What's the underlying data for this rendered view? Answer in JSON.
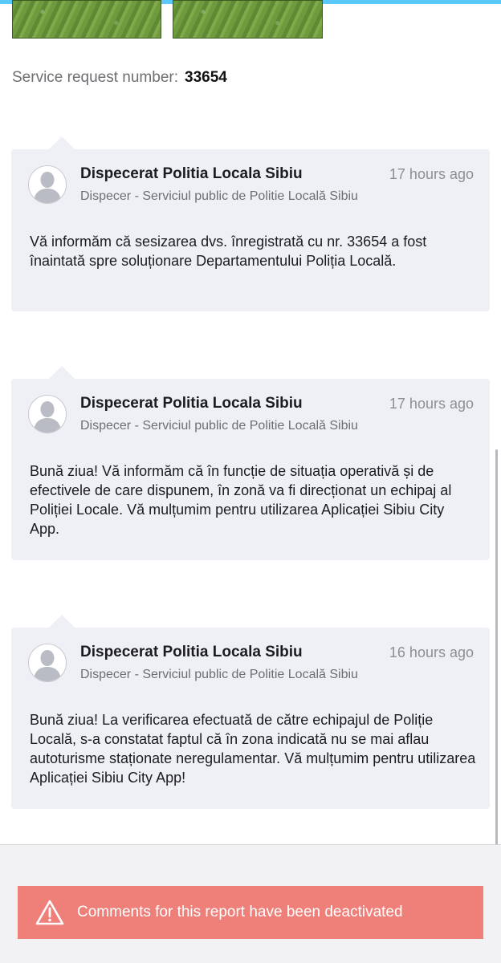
{
  "request": {
    "label": "Service request number:",
    "number": "33654"
  },
  "comments": [
    {
      "author": "Dispecerat Politia Locala Sibiu",
      "role": "Dispecer - Serviciul public de Politie Locală Sibiu",
      "time": "17 hours ago",
      "message": "Vă informăm că sesizarea dvs. înregistrată cu nr. 33654 a fost înaintată spre soluționare Departamentului Poliția Locală."
    },
    {
      "author": "Dispecerat Politia Locala Sibiu",
      "role": "Dispecer - Serviciul public de Politie Locală Sibiu",
      "time": "17 hours ago",
      "message": "Bună ziua! Vă informăm că în funcție de situația operativă și de efectivele de care dispunem, în zonă va fi direcționat un echipaj al Poliției Locale. Vă mulțumim pentru utilizarea Aplicației Sibiu City App."
    },
    {
      "author": "Dispecerat Politia Locala Sibiu",
      "role": "Dispecer - Serviciul public de Politie Locală Sibiu",
      "time": "16 hours ago",
      "message": "Bună ziua! La verificarea efectuată de către echipajul de Poliție Locală, s-a constatat faptul că în zona indicată nu se mai aflau autoturisme staționate neregulamentar. Vă mulțumim pentru utilizarea Aplicației Sibiu City App!"
    }
  ],
  "footer": {
    "banner_text": "Comments for this report have been deactivated",
    "banner_icon": "warning-icon",
    "banner_color": "#ee7f79"
  },
  "colors": {
    "accent_bar": "#5ac8fa",
    "card_background": "#eef0f5"
  }
}
